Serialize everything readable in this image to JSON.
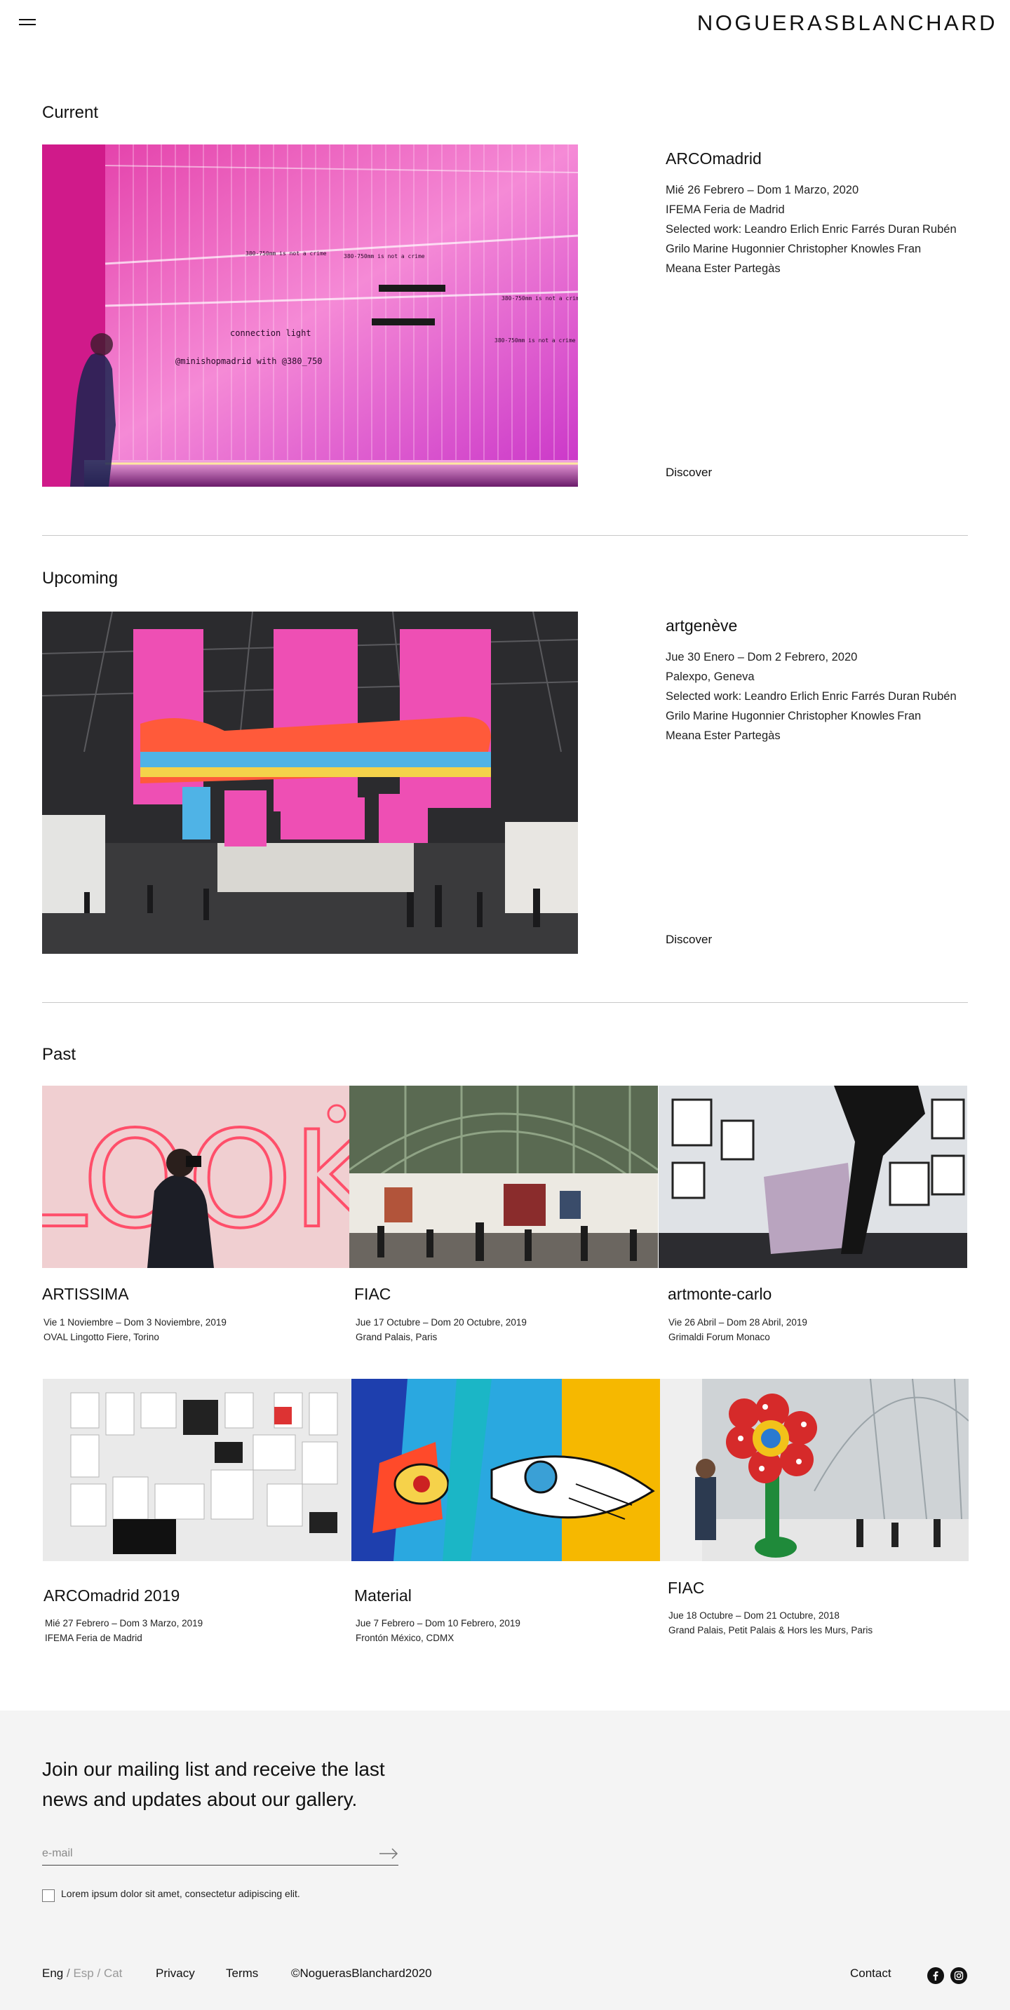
{
  "header": {
    "logo": "NOGUERASBLANCHARD"
  },
  "current": {
    "section_title": "Current",
    "title": "ARCOmadrid",
    "dates": "Mié 26 Febrero – Dom 1 Marzo, 2020",
    "venue": "IFEMA Feria de Madrid",
    "works_label": "Selected work:",
    "artists": [
      "Leandro Erlich",
      "Enric Farrés Duran",
      "Rubén Grilo",
      "Marine Hugonnier",
      "Christopher Knowles",
      "Fran Meana",
      "Ester Partegàs"
    ],
    "image_texts": [
      "380-750mm is not a crime",
      "380-750mm is not a crime",
      "connection light",
      "@minishopmadrid with @380_750",
      "380-750mm is not a crime",
      "380-750mm is not a crime"
    ],
    "discover": "Discover"
  },
  "upcoming": {
    "section_title": "Upcoming",
    "title": "artgenève",
    "dates": "Jue 30 Enero – Dom 2 Febrero, 2020",
    "venue": "Palexpo, Geneva",
    "works_label": "Selected work:",
    "artists": [
      "Leandro Erlich",
      "Enric Farrés Duran",
      "Rubén Grilo",
      "Marine Hugonnier",
      "Christopher Knowles",
      "Fran Meana",
      "Ester Partegàs"
    ],
    "discover": "Discover"
  },
  "past": {
    "section_title": "Past",
    "items": [
      {
        "title": "ARTISSIMA",
        "dates": "Vie 1 Noviembre – Dom 3 Noviembre, 2019",
        "venue": "OVAL Lingotto Fiere, Torino",
        "image_text": "LOOK"
      },
      {
        "title": "FIAC",
        "dates": "Jue 17 Octubre – Dom 20 Octubre, 2019",
        "venue": "Grand Palais, Paris"
      },
      {
        "title": "artmonte-carlo",
        "dates": "Vie 26 Abril – Dom 28 Abril, 2019",
        "venue": "Grimaldi Forum Monaco"
      },
      {
        "title": "ARCOmadrid 2019",
        "dates": "Mié 27 Febrero – Dom 3 Marzo, 2019",
        "venue": "IFEMA Feria de Madrid"
      },
      {
        "title": "Material",
        "dates": "Jue 7 Febrero – Dom 10 Febrero, 2019",
        "venue": "Frontón México, CDMX"
      },
      {
        "title": "FIAC",
        "dates": "Jue 18 Octubre – Dom 21 Octubre, 2018",
        "venue": "Grand Palais, Petit Palais & Hors les Murs, Paris"
      }
    ]
  },
  "newsletter": {
    "text": "Join our mailing list and receive the last news and updates about our gallery.",
    "email_placeholder": "e-mail",
    "checkbox_label": "Lorem ipsum dolor sit amet, consectetur adipiscing elit."
  },
  "footer": {
    "lang_eng": "Eng",
    "lang_esp": "Esp",
    "lang_cat": "Cat",
    "lang_sep": "/",
    "privacy": "Privacy",
    "terms": "Terms",
    "copyright": "©NoguerasBlanchard2020",
    "contact": "Contact",
    "icons": [
      "facebook-icon",
      "instagram-icon"
    ]
  },
  "colors": {
    "background": "#ffffff",
    "newsletter_bg": "#f4f4f4",
    "text": "#111111",
    "divider": "#c9c9c9"
  }
}
